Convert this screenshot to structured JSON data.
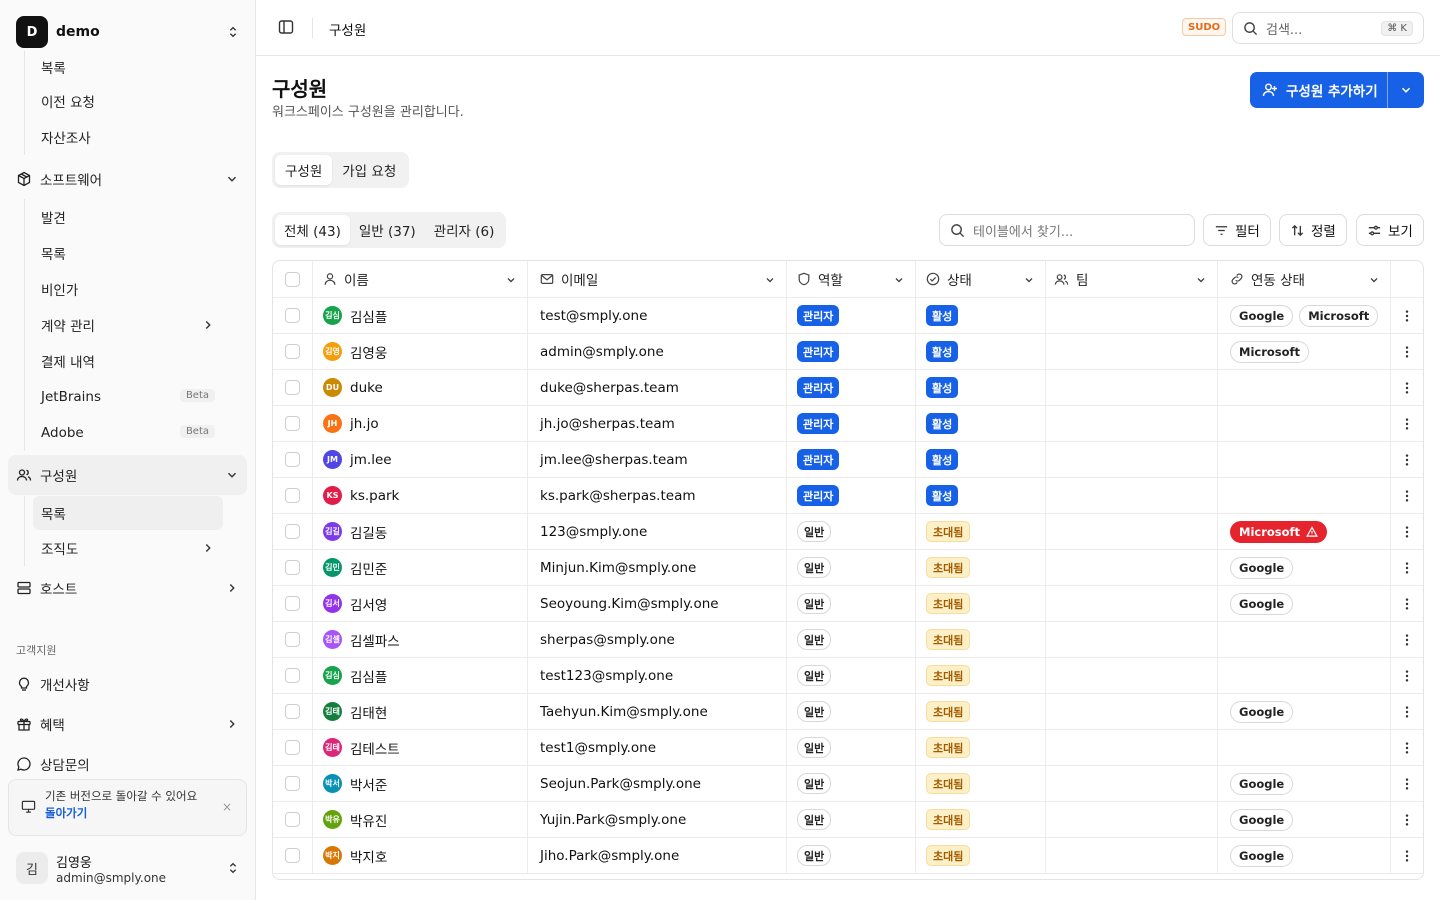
{
  "workspace": {
    "initial": "D",
    "name": "demo"
  },
  "sidebar": {
    "top_items": [
      "복록",
      "이전 요청",
      "자산조사"
    ],
    "software": {
      "label": "소프트웨어",
      "items": [
        {
          "label": "발견"
        },
        {
          "label": "목록"
        },
        {
          "label": "비인가"
        },
        {
          "label": "계약 관리",
          "has_children": true
        },
        {
          "label": "결제 내역"
        },
        {
          "label": "JetBrains",
          "badge": "Beta"
        },
        {
          "label": "Adobe",
          "badge": "Beta"
        }
      ]
    },
    "members": {
      "label": "구성원",
      "items": [
        {
          "label": "목록",
          "active": true
        },
        {
          "label": "조직도",
          "has_children": true
        }
      ]
    },
    "host": {
      "label": "호스트"
    },
    "support_section": "고객지원",
    "support_items": [
      {
        "label": "개선사항",
        "icon": "lightbulb-icon"
      },
      {
        "label": "혜택",
        "icon": "gift-icon",
        "has_children": true
      },
      {
        "label": "상담문의",
        "icon": "chat-icon"
      }
    ],
    "notice": {
      "text": "기존 버전으로 돌아갈 수 있어요",
      "link": "돌아가기",
      "close": "×"
    },
    "user": {
      "avatar": "김",
      "name": "김영웅",
      "email": "admin@smply.one"
    }
  },
  "topbar": {
    "title": "구성원",
    "sudo": "SUDO",
    "search_placeholder": "검색...",
    "shortcut": "⌘ K"
  },
  "page": {
    "title": "구성원",
    "description": "워크스페이스 구성원을 관리합니다.",
    "add_button": "구성원 추가하기"
  },
  "tabs": [
    {
      "label": "구성원",
      "active": true
    },
    {
      "label": "가입 요청",
      "active": false
    }
  ],
  "filter_tabs": [
    {
      "label": "전체 (43)",
      "active": true
    },
    {
      "label": "일반 (37)",
      "active": false
    },
    {
      "label": "관리자 (6)",
      "active": false
    }
  ],
  "toolbar": {
    "search_placeholder": "테이블에서 찾기...",
    "filter": "필터",
    "sort": "정렬",
    "view": "보기"
  },
  "columns": {
    "name": "이름",
    "email": "이메일",
    "role": "역할",
    "status": "상태",
    "team": "팀",
    "link": "연동 상태"
  },
  "colors": {
    "accent": "#1761e6",
    "warning_bg": "#fdf0c7",
    "error": "#e5242d"
  },
  "rows": [
    {
      "avatar": "김심",
      "color": "#16a34a",
      "name": "김심플",
      "email": "test@smply.one",
      "role": "관리자",
      "role_type": "admin",
      "status": "활성",
      "status_type": "active",
      "team": "",
      "links": [
        {
          "label": "Google"
        },
        {
          "label": "Microsoft"
        }
      ]
    },
    {
      "avatar": "김영",
      "color": "#f59e0b",
      "name": "김영웅",
      "email": "admin@smply.one",
      "role": "관리자",
      "role_type": "admin",
      "status": "활성",
      "status_type": "active",
      "team": "",
      "links": [
        {
          "label": "Microsoft"
        }
      ]
    },
    {
      "avatar": "DU",
      "color": "#ca8a04",
      "name": "duke",
      "email": "duke@sherpas.team",
      "role": "관리자",
      "role_type": "admin",
      "status": "활성",
      "status_type": "active",
      "team": "",
      "links": []
    },
    {
      "avatar": "JH",
      "color": "#f97316",
      "name": "jh.jo",
      "email": "jh.jo@sherpas.team",
      "role": "관리자",
      "role_type": "admin",
      "status": "활성",
      "status_type": "active",
      "team": "",
      "links": []
    },
    {
      "avatar": "JM",
      "color": "#4f46e5",
      "name": "jm.lee",
      "email": "jm.lee@sherpas.team",
      "role": "관리자",
      "role_type": "admin",
      "status": "활성",
      "status_type": "active",
      "team": "",
      "links": []
    },
    {
      "avatar": "KS",
      "color": "#e11d48",
      "name": "ks.park",
      "email": "ks.park@sherpas.team",
      "role": "관리자",
      "role_type": "admin",
      "status": "활성",
      "status_type": "active",
      "team": "",
      "links": []
    },
    {
      "avatar": "김길",
      "color": "#7c3aed",
      "name": "김길동",
      "email": "123@smply.one",
      "role": "일반",
      "role_type": "general",
      "status": "초대됨",
      "status_type": "invited",
      "team": "",
      "links": [
        {
          "label": "Microsoft",
          "error": true
        }
      ]
    },
    {
      "avatar": "김민",
      "color": "#059669",
      "name": "김민준",
      "email": "Minjun.Kim@smply.one",
      "role": "일반",
      "role_type": "general",
      "status": "초대됨",
      "status_type": "invited",
      "team": "",
      "links": [
        {
          "label": "Google"
        }
      ]
    },
    {
      "avatar": "김서",
      "color": "#9333ea",
      "name": "김서영",
      "email": "Seoyoung.Kim@smply.one",
      "role": "일반",
      "role_type": "general",
      "status": "초대됨",
      "status_type": "invited",
      "team": "",
      "links": [
        {
          "label": "Google"
        }
      ]
    },
    {
      "avatar": "김셀",
      "color": "#a855f7",
      "name": "김셀파스",
      "email": "sherpas@smply.one",
      "role": "일반",
      "role_type": "general",
      "status": "초대됨",
      "status_type": "invited",
      "team": "",
      "links": []
    },
    {
      "avatar": "김심",
      "color": "#16a34a",
      "name": "김심플",
      "email": "test123@smply.one",
      "role": "일반",
      "role_type": "general",
      "status": "초대됨",
      "status_type": "invited",
      "team": "",
      "links": []
    },
    {
      "avatar": "김태",
      "color": "#15803d",
      "name": "김태현",
      "email": "Taehyun.Kim@smply.one",
      "role": "일반",
      "role_type": "general",
      "status": "초대됨",
      "status_type": "invited",
      "team": "",
      "links": [
        {
          "label": "Google"
        }
      ]
    },
    {
      "avatar": "김테",
      "color": "#db2777",
      "name": "김테스트",
      "email": "test1@smply.one",
      "role": "일반",
      "role_type": "general",
      "status": "초대됨",
      "status_type": "invited",
      "team": "",
      "links": []
    },
    {
      "avatar": "박서",
      "color": "#0891b2",
      "name": "박서준",
      "email": "Seojun.Park@smply.one",
      "role": "일반",
      "role_type": "general",
      "status": "초대됨",
      "status_type": "invited",
      "team": "",
      "links": [
        {
          "label": "Google"
        }
      ]
    },
    {
      "avatar": "박유",
      "color": "#65a30d",
      "name": "박유진",
      "email": "Yujin.Park@smply.one",
      "role": "일반",
      "role_type": "general",
      "status": "초대됨",
      "status_type": "invited",
      "team": "",
      "links": [
        {
          "label": "Google"
        }
      ]
    },
    {
      "avatar": "박지",
      "color": "#d97706",
      "name": "박지호",
      "email": "Jiho.Park@smply.one",
      "role": "일반",
      "role_type": "general",
      "status": "초대됨",
      "status_type": "invited",
      "team": "",
      "links": [
        {
          "label": "Google"
        }
      ]
    }
  ]
}
